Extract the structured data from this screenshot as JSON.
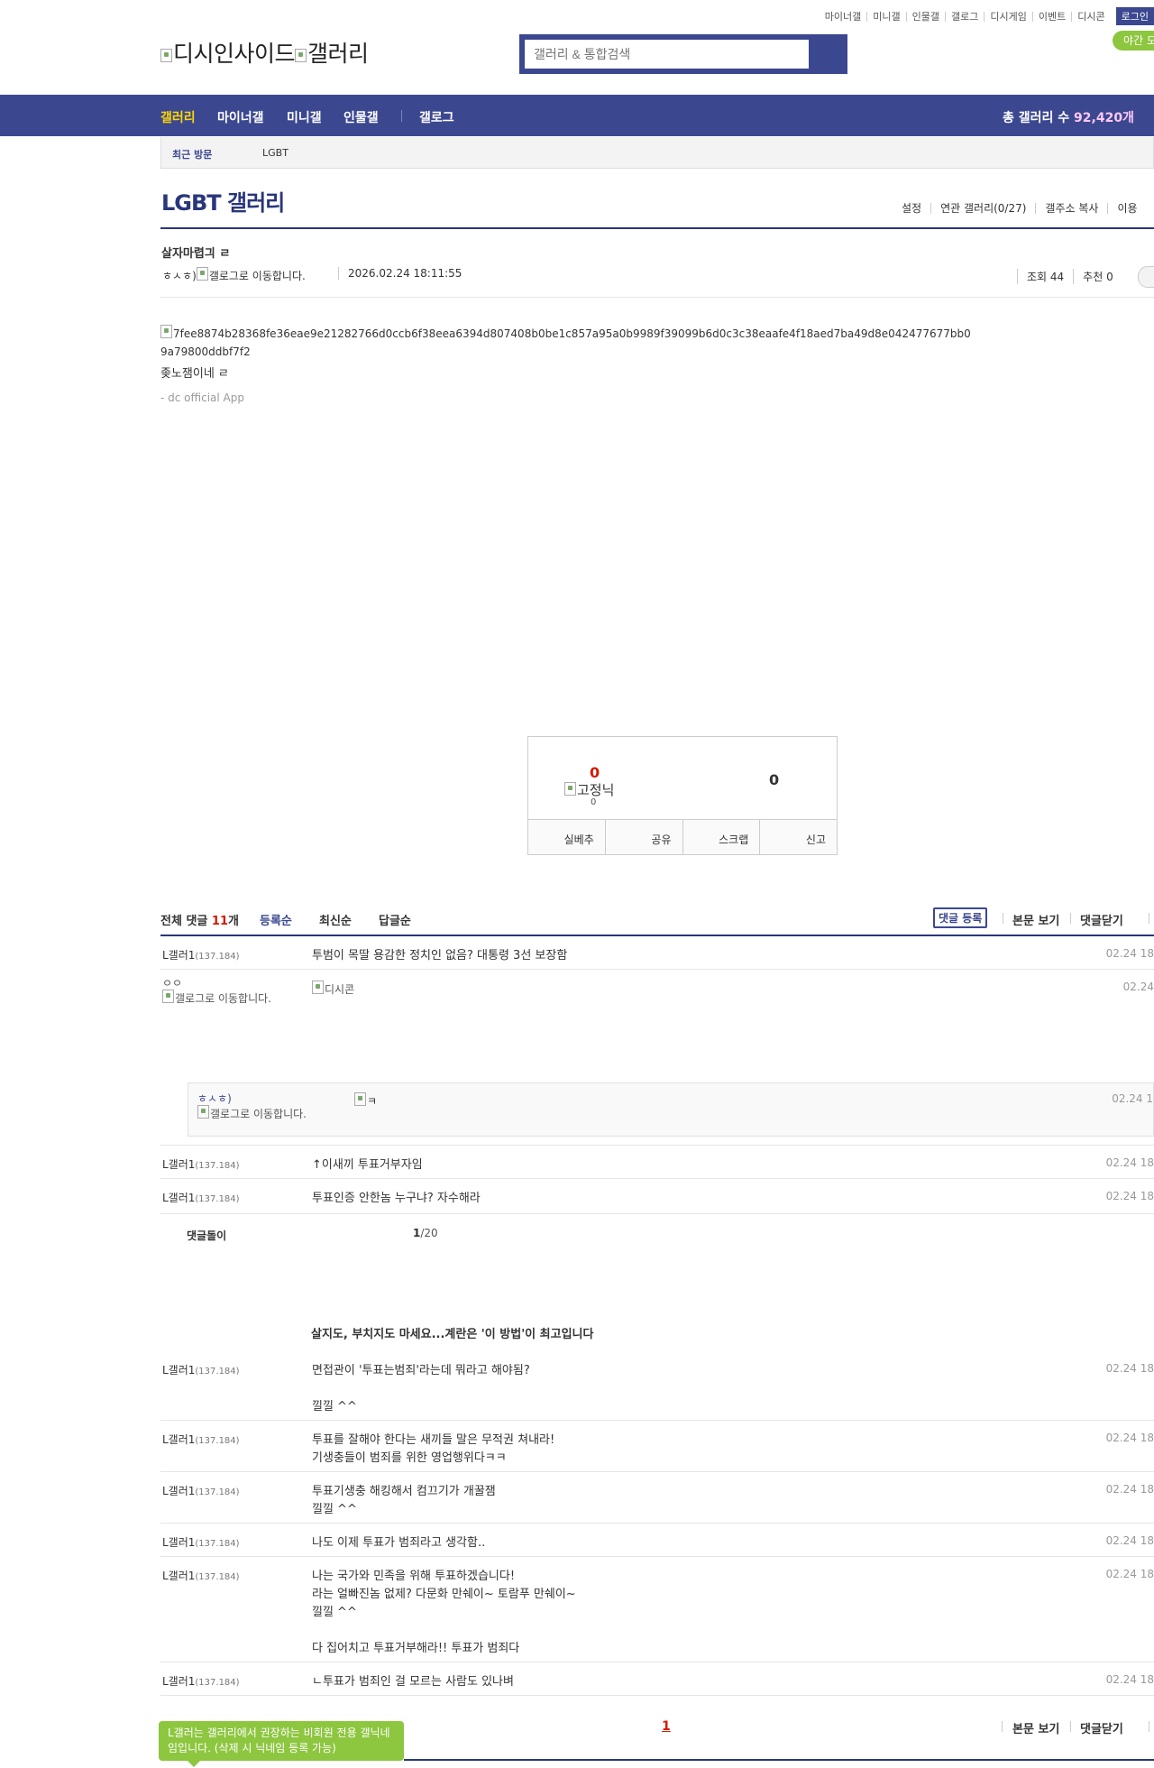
{
  "util_links": [
    "마이너갤",
    "미니갤",
    "인물갤",
    "갤로그",
    "디시게임",
    "이벤트",
    "디시콘"
  ],
  "login_label": "로그인",
  "logo": {
    "site": "디시인사이드",
    "section": "갤러리"
  },
  "search": {
    "placeholder": "갤러리 & 통합검색"
  },
  "night_mode": "야간 모",
  "nav": {
    "items": [
      "갤러리",
      "마이너갤",
      "미니갤",
      "인물갤"
    ],
    "gallog": "갤로그",
    "total_prefix": "총 갤러리 수 ",
    "total_count": "92,420개"
  },
  "recent": {
    "label": "최근 방문",
    "value": "LGBT"
  },
  "gallery": {
    "title": "LGBT 갤러리",
    "menu": [
      "설정",
      "연관 갤러리(0/27)",
      "갤주소 복사",
      "이용"
    ]
  },
  "post": {
    "title": "살자마렵긔 ㄹ",
    "writer_prefix": "ㅎㅅㅎ)",
    "writer_img_alt": "갤로그로 이동합니다.",
    "date": "2026.02.24 18:11:55",
    "views": "조회 44",
    "recommend": "추천 0",
    "image_alt": "7fee8874b28368fe36eae9e21282766d0ccb6f38eea6394d807408b0be1c857a95a0b9989f39099b6d0c3c38eaafe4f18aed7ba49d8e042477677bb09a79800ddbf7f2",
    "body": "좆노잼이네 ㄹ",
    "app": "- dc official App"
  },
  "recommend_box": {
    "up": "0",
    "fixed_nick": "고정닉",
    "fixed_count": "0",
    "down": "0",
    "buttons": [
      "실베추",
      "공유",
      "스크랩",
      "신고"
    ]
  },
  "comments": {
    "total_label": "전체 댓글 ",
    "total_count": "11",
    "total_unit": "개",
    "sorts": [
      "등록순",
      "최신순",
      "답글순"
    ],
    "write": "댓글 등록",
    "view_body": "본문 보기",
    "close": "댓글닫기",
    "rows": [
      {
        "nick": "L갤러1",
        "ip": "(137.184)",
        "text": "투범이 목딸 용감한 정치인 없음? 대통령 3선 보장함",
        "time": "02.24 18"
      },
      {
        "nick": "L갤러1",
        "ip": "(137.184)",
        "text": "↑이새끼 투표거부자임",
        "time": "02.24 18"
      },
      {
        "nick": "L갤러1",
        "ip": "(137.184)",
        "text": "투표인증 안한놈 누구냐? 자수해라",
        "time": "02.24 18"
      }
    ],
    "dccon_row": {
      "nick": "ㅇㅇ",
      "img_alt": "갤로그로 이동합니다.",
      "dccon_alt": "디시콘",
      "time": "02.24"
    },
    "reply": {
      "nick": "ㅎㅅㅎ)",
      "img_alt": "갤로그로 이동합니다.",
      "dccon_alt": "ㅋ",
      "time": "02.24 1"
    },
    "bot_label": "댓글돌이",
    "page_current": "1",
    "page_total": "/20"
  },
  "ad_title": "살지도, 부치지도 마세요...계란은 '이 방법'이 최고입니다",
  "bot_comments": [
    {
      "nick": "L갤러1",
      "ip": "(137.184)",
      "text": "면접관이 '투표는범죄'라는데 뭐라고 해야됨?\n\n낄낄 ^^",
      "time": "02.24 18"
    },
    {
      "nick": "L갤러1",
      "ip": "(137.184)",
      "text": "투표를 잘해야 한다는 새끼들 말은 무적권 쳐내라!\n기생충들이 범죄를 위한 영업행위다ㅋㅋ",
      "time": "02.24 18"
    },
    {
      "nick": "L갤러1",
      "ip": "(137.184)",
      "text": "투표기생충 해킹해서 컴끄기가 개꿀잼\n낄낄 ^^",
      "time": "02.24 18"
    },
    {
      "nick": "L갤러1",
      "ip": "(137.184)",
      "text": "나도 이제 투표가 범죄라고 생각함..",
      "time": "02.24 18"
    },
    {
      "nick": "L갤러1",
      "ip": "(137.184)",
      "text": "나는 국가와 민족을 위해 투표하겠습니다!\n라는 얼빠진놈 없제? 다문화 만쉐이~ 토람푸 만쉐이~\n낄낄 ^^\n\n다 집어치고 투표거부해라!! 투표가 범죄다",
      "time": "02.24 18"
    },
    {
      "nick": "L갤러1",
      "ip": "(137.184)",
      "text": "ㄴ투표가 범죄인 걸 모르는 사람도 있나벼",
      "time": "02.24 18"
    }
  ],
  "footer": {
    "page": "1",
    "view_body": "본문 보기",
    "close": "댓글닫기",
    "tooltip": "L갤러는 갤러리에서 권장하는 비회원 전용 갤닉네임입니다. (삭제 시 닉네임 등록 가능)"
  },
  "colors": {
    "brand": "#3b4890",
    "accent_red": "#d31900",
    "nav_active": "#ffd700",
    "green": "#8dc63f"
  }
}
